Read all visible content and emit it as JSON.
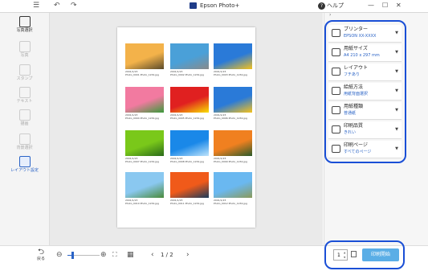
{
  "app": {
    "title": "Epson Photo+",
    "help_label": "ヘルプ"
  },
  "titlebar": {
    "menu_icon": "menu-icon",
    "undo_icon": "undo-icon",
    "redo_icon": "redo-icon"
  },
  "sidebar": {
    "items": [
      {
        "label": "写真選択",
        "icon": "photo-select-icon",
        "state": "enabled"
      },
      {
        "label": "写真",
        "icon": "person-icon",
        "state": "disabled"
      },
      {
        "label": "スタンプ",
        "icon": "stamp-icon",
        "state": "disabled"
      },
      {
        "label": "テキスト",
        "icon": "text-icon",
        "state": "disabled"
      },
      {
        "label": "描画",
        "icon": "draw-icon",
        "state": "disabled"
      },
      {
        "label": "背景選択",
        "icon": "background-icon",
        "state": "disabled"
      },
      {
        "label": "レイアウト設定",
        "icon": "layout-icon",
        "state": "active"
      }
    ]
  },
  "preview": {
    "photos": [
      {
        "caption1": "2001/1/23",
        "caption2": "Photo_0001 Photo_1234.jpg",
        "colors": [
          "#f3b24a",
          "#5a4a2a"
        ]
      },
      {
        "caption1": "2001/1/23",
        "caption2": "Photo_0002 Photo_1234.jpg",
        "colors": [
          "#4aa0d8",
          "#8a8a8a"
        ]
      },
      {
        "caption1": "2001/1/23",
        "caption2": "Photo_0003 Photo_1234.jpg",
        "colors": [
          "#2a7ad8",
          "#f6c21b"
        ]
      },
      {
        "caption1": "2001/1/23",
        "caption2": "Photo_0004 Photo_1234.jpg",
        "colors": [
          "#f27aa0",
          "#3a9a3a"
        ]
      },
      {
        "caption1": "2001/1/23",
        "caption2": "Photo_0005 Photo_1234.jpg",
        "colors": [
          "#e02020",
          "#f8e000"
        ]
      },
      {
        "caption1": "2001/1/23",
        "caption2": "Photo_0006 Photo_1234.jpg",
        "colors": [
          "#2a7ad8",
          "#f6c21b"
        ]
      },
      {
        "caption1": "2001/1/23",
        "caption2": "Photo_0007 Photo_1234.jpg",
        "colors": [
          "#7ac81a",
          "#2a6a1a"
        ]
      },
      {
        "caption1": "2001/1/23",
        "caption2": "Photo_0008 Photo_1234.jpg",
        "colors": [
          "#1a88e8",
          "#bfe4fb"
        ]
      },
      {
        "caption1": "2001/1/23",
        "caption2": "Photo_0009 Photo_1234.jpg",
        "colors": [
          "#f08020",
          "#2a5a2a"
        ]
      },
      {
        "caption1": "2001/1/23",
        "caption2": "Photo_0010 Photo_1234.jpg",
        "colors": [
          "#8ac8f0",
          "#4a8a3a"
        ]
      },
      {
        "caption1": "2001/1/23",
        "caption2": "Photo_0011 Photo_1234.jpg",
        "colors": [
          "#f05a1a",
          "#1a3a5a"
        ]
      },
      {
        "caption1": "2001/1/23",
        "caption2": "Photo_0012 Photo_1234.jpg",
        "colors": [
          "#6ab8f0",
          "#8a9a5a"
        ]
      }
    ]
  },
  "settings": [
    {
      "title": "プリンター",
      "value": "EPSON XX-XXXX",
      "icon": "printer-icon"
    },
    {
      "title": "用紙サイズ",
      "value": "A4 210 x 297 mm",
      "icon": "paper-size-icon"
    },
    {
      "title": "レイアウト",
      "value": "フチあり",
      "icon": "layout-border-icon"
    },
    {
      "title": "給紙方法",
      "value": "用紙背面選択",
      "icon": "paper-feed-icon"
    },
    {
      "title": "用紙種類",
      "value": "普通紙",
      "icon": "paper-type-icon"
    },
    {
      "title": "印刷品質",
      "value": "きれい",
      "icon": "print-quality-icon"
    },
    {
      "title": "印刷ページ",
      "value": "すべてのページ",
      "icon": "print-pages-icon"
    }
  ],
  "bottom": {
    "back_label": "戻る",
    "page_indicator": "1 / 2",
    "copies": "1",
    "print_label": "印刷開始",
    "zoom_level": 0.15
  },
  "colors": {
    "accent": "#2a63c6",
    "highlight": "#1a4fd6",
    "print_button": "#5aaee6"
  }
}
